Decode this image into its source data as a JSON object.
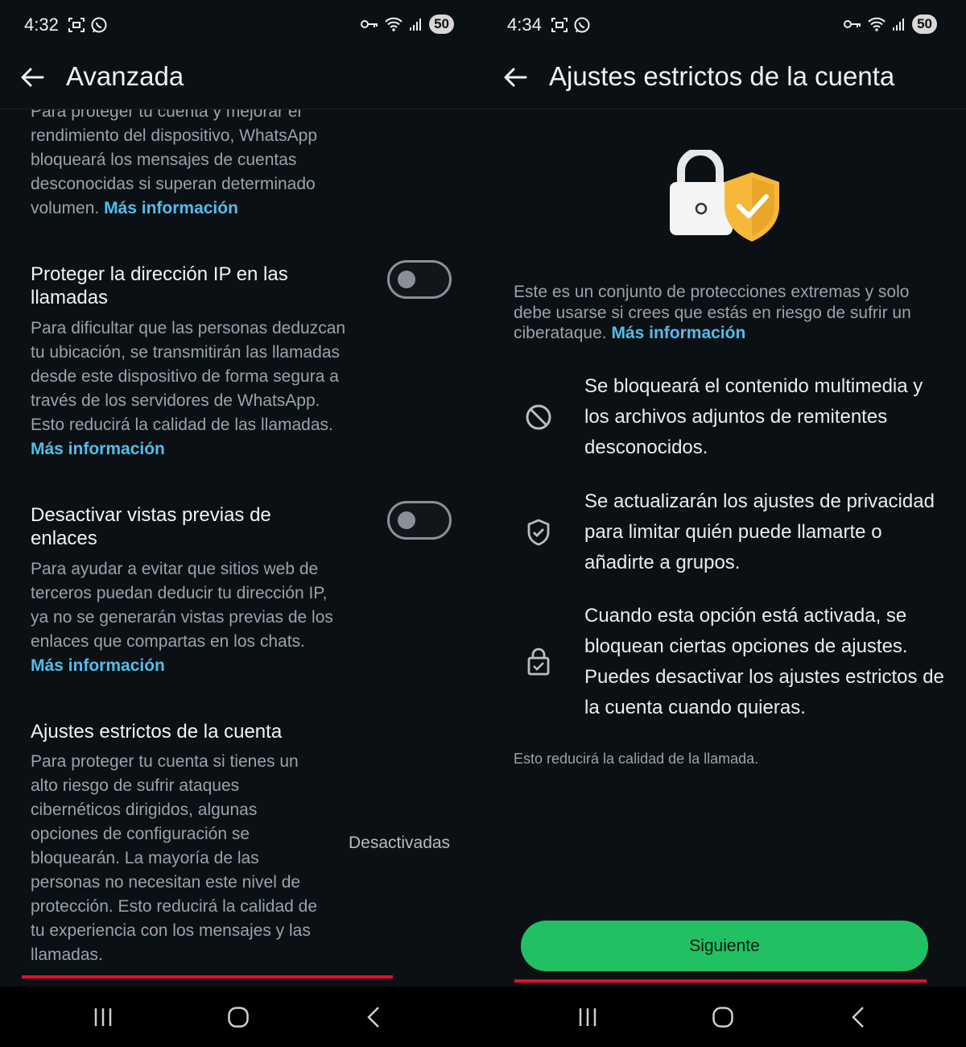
{
  "left": {
    "status": {
      "time": "4:32",
      "battery": "50"
    },
    "appbar": {
      "title": "Avanzada"
    },
    "top_desc": "Para proteger tu cuenta y mejorar el rendimiento del dispositivo, WhatsApp bloqueará los mensajes de cuentas desconocidas si superan determinado volumen.",
    "top_desc_link": "Más información",
    "settings": [
      {
        "title": "Proteger la dirección IP en las llamadas",
        "desc": "Para dificultar que las personas deduzcan tu ubicación, se transmitirán las llamadas desde este dispositivo de forma segura a través de los servidores de WhatsApp. Esto reducirá la calidad de las llamadas.",
        "link": "Más información",
        "enabled": false
      },
      {
        "title": "Desactivar vistas previas de enlaces",
        "desc": "Para ayudar a evitar que sitios web de terceros puedan deducir tu dirección IP, ya no se generarán vistas previas de los enlaces que compartas en los chats.",
        "link": "Más información",
        "enabled": false
      },
      {
        "title": "Ajustes estrictos de la cuenta",
        "desc": "Para proteger tu cuenta si tienes un alto riesgo de sufrir ataques cibernéticos dirigidos, algunas opciones de configuración se bloquearán. La mayoría de las personas no necesitan este nivel de protección. Esto reducirá la calidad de tu experiencia con los mensajes y las llamadas.",
        "value": "Desactivadas"
      }
    ]
  },
  "right": {
    "status": {
      "time": "4:34",
      "battery": "50"
    },
    "appbar": {
      "title": "Ajustes estrictos de la cuenta"
    },
    "intro": "Este es un conjunto de protecciones extremas y solo debe usarse si crees que estás en riesgo de sufrir un ciberataque.",
    "intro_link": "Más información",
    "items": [
      {
        "icon": "block-icon",
        "text": "Se bloqueará el contenido multimedia y los archivos adjuntos de remitentes desconocidos."
      },
      {
        "icon": "shield-check-icon",
        "text": "Se actualizarán los ajustes de privacidad para limitar quién puede llamarte o añadirte a grupos."
      },
      {
        "icon": "lock-check-icon",
        "text": "Cuando esta opción está activada, se bloquean ciertas opciones de ajustes. Puedes desactivar los ajustes estrictos de la cuenta cuando quieras."
      }
    ],
    "note": "Esto reducirá la calidad de la llamada.",
    "button": "Siguiente"
  },
  "colors": {
    "background": "#0b1014",
    "link": "#53bdeb",
    "primary_button": "#21c063",
    "highlight_underline": "#e0112b",
    "shield": "#f5b83a"
  }
}
